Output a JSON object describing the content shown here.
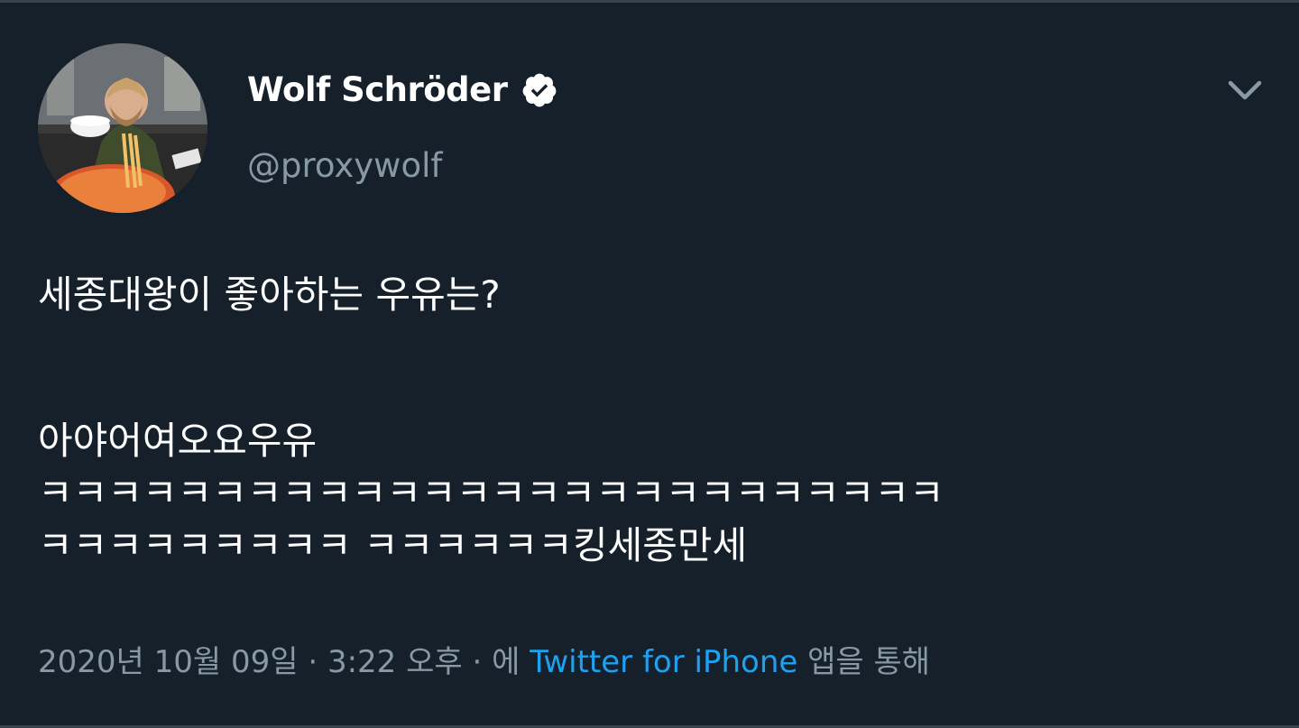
{
  "tweet": {
    "author": {
      "display_name": "Wolf Schröder",
      "handle": "@proxywolf",
      "verified": true,
      "avatar_icon": "user-avatar-photo"
    },
    "menu_icon": "chevron-down-icon",
    "text_lines": [
      "세종대왕이 좋아하는 우유는?",
      "",
      "아야어여오요우유",
      "ㅋㅋㅋㅋㅋㅋㅋㅋㅋㅋㅋㅋㅋㅋㅋㅋㅋㅋㅋㅋㅋㅋㅋㅋㅋㅋ",
      "ㅋㅋㅋㅋㅋㅋㅋㅋㅋ ㅋㅋㅋㅋㅋㅋ킹세종만세"
    ],
    "meta": {
      "date": "2020년 10월 09일",
      "sep1": " · ",
      "time": "3:22 오후",
      "sep2": " · ",
      "via_prefix": "에 ",
      "source": "Twitter for iPhone",
      "via_suffix": " 앱을 통해"
    }
  },
  "colors": {
    "background": "#15202b",
    "primary_text": "#ffffff",
    "secondary_text": "#8899a6",
    "link": "#1da1f2",
    "divider": "#38444d"
  }
}
